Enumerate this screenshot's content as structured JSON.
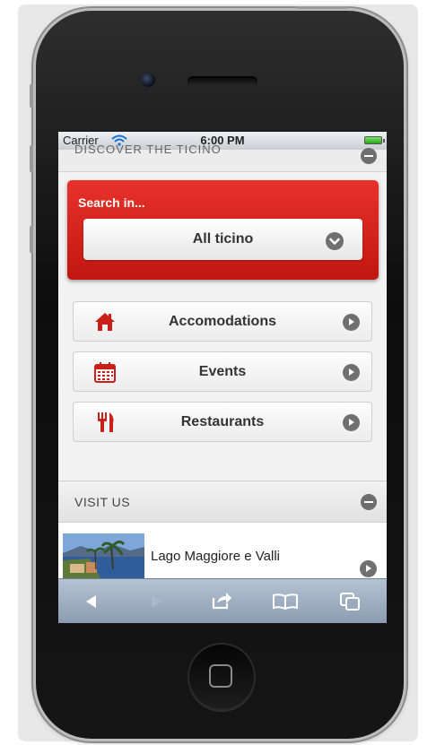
{
  "status_bar": {
    "carrier": "Carrier",
    "time": "6:00 PM"
  },
  "partial_header": {
    "title": "DISCOVER THE TICINO"
  },
  "search": {
    "title": "Search in...",
    "selected": "All ticino"
  },
  "categories": [
    {
      "label": "Accomodations",
      "icon": "house-icon"
    },
    {
      "label": "Events",
      "icon": "calendar-icon"
    },
    {
      "label": "Restaurants",
      "icon": "fork-knife-icon"
    }
  ],
  "visit_us": {
    "title": "VISIT US",
    "items": [
      {
        "label": "Lago Maggiore e Valli"
      }
    ]
  },
  "toolbar": {
    "icons": [
      "back-icon",
      "forward-icon",
      "share-icon",
      "bookmarks-icon",
      "tabs-icon"
    ]
  },
  "colors": {
    "accent_red": "#d3221b",
    "toolbar_blue": "#9fb0c6",
    "icon_grey": "#707070"
  }
}
